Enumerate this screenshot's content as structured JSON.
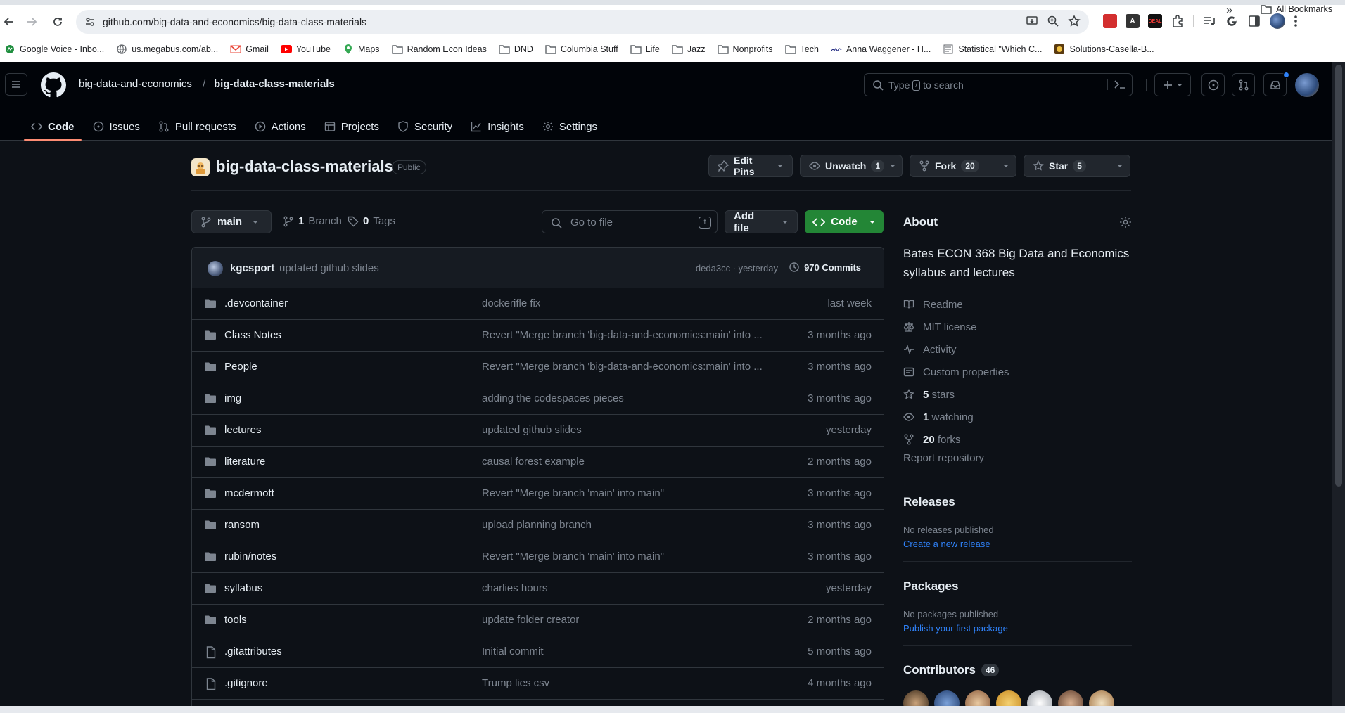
{
  "browser": {
    "url": "github.com/big-data-and-economics/big-data-class-materials",
    "bookmarks": [
      {
        "label": "Google Voice - Inbo...",
        "icon": "google-voice-icon"
      },
      {
        "label": "us.megabus.com/ab...",
        "icon": "globe-icon"
      },
      {
        "label": "Gmail",
        "icon": "gmail-icon"
      },
      {
        "label": "YouTube",
        "icon": "youtube-icon"
      },
      {
        "label": "Maps",
        "icon": "maps-pin-icon"
      },
      {
        "label": "Random Econ Ideas",
        "icon": "folder-icon"
      },
      {
        "label": "DND",
        "icon": "folder-icon"
      },
      {
        "label": "Columbia Stuff",
        "icon": "folder-icon"
      },
      {
        "label": "Life",
        "icon": "folder-icon"
      },
      {
        "label": "Jazz",
        "icon": "folder-icon"
      },
      {
        "label": "Nonprofits",
        "icon": "folder-icon"
      },
      {
        "label": "Tech",
        "icon": "folder-icon"
      },
      {
        "label": "Anna Waggener - H...",
        "icon": "signature-icon"
      },
      {
        "label": "Statistical \"Which C...",
        "icon": "doc-icon"
      },
      {
        "label": "Solutions-Casella-B...",
        "icon": "logo-icon"
      }
    ],
    "more_bookmarks": "»",
    "all_bookmarks": "All Bookmarks",
    "ext_labels": {
      "first": "",
      "second": "A",
      "third": "DEAL"
    }
  },
  "header": {
    "owner": "big-data-and-economics",
    "separator": "/",
    "repo": "big-data-class-materials",
    "search_prefix": "Type",
    "search_key": "/",
    "search_suffix": "to search"
  },
  "tabs": [
    {
      "label": "Code",
      "icon": "code-icon",
      "active": true
    },
    {
      "label": "Issues",
      "icon": "issue-icon"
    },
    {
      "label": "Pull requests",
      "icon": "pull-request-icon"
    },
    {
      "label": "Actions",
      "icon": "play-icon"
    },
    {
      "label": "Projects",
      "icon": "table-icon"
    },
    {
      "label": "Security",
      "icon": "shield-icon"
    },
    {
      "label": "Insights",
      "icon": "graph-icon"
    },
    {
      "label": "Settings",
      "icon": "gear-icon"
    }
  ],
  "repo": {
    "title": "big-data-class-materials",
    "visibility": "Public",
    "edit_pins": "Edit Pins",
    "unwatch": "Unwatch",
    "watch_count": "1",
    "fork": "Fork",
    "fork_count": "20",
    "star": "Star",
    "star_count": "5"
  },
  "branch_bar": {
    "branch": "main",
    "branches_count": "1",
    "branches_label": "Branch",
    "tags_count": "0",
    "tags_label": "Tags",
    "goto_placeholder": "Go to file",
    "goto_key": "t",
    "add_file": "Add file",
    "code": "Code"
  },
  "latest_commit": {
    "author": "kgcsport",
    "message": "updated github slides",
    "sha_time": "deda3cc · yesterday",
    "commits": "970 Commits"
  },
  "files": [
    {
      "name": ".devcontainer",
      "type": "dir",
      "commit": "dockerifle fix",
      "time": "last week"
    },
    {
      "name": "Class Notes",
      "type": "dir",
      "commit": "Revert \"Merge branch 'big-data-and-economics:main' into ...",
      "time": "3 months ago"
    },
    {
      "name": "People",
      "type": "dir",
      "commit": "Revert \"Merge branch 'big-data-and-economics:main' into ...",
      "time": "3 months ago"
    },
    {
      "name": "img",
      "type": "dir",
      "commit": "adding the codespaces pieces",
      "time": "3 months ago"
    },
    {
      "name": "lectures",
      "type": "dir",
      "commit": "updated github slides",
      "time": "yesterday"
    },
    {
      "name": "literature",
      "type": "dir",
      "commit": "causal forest example",
      "time": "2 months ago"
    },
    {
      "name": "mcdermott",
      "type": "dir",
      "commit": "Revert \"Merge branch 'main' into main\"",
      "time": "3 months ago"
    },
    {
      "name": "ransom",
      "type": "dir",
      "commit": "upload planning branch",
      "time": "3 months ago"
    },
    {
      "name": "rubin/notes",
      "type": "dir",
      "commit": "Revert \"Merge branch 'main' into main\"",
      "time": "3 months ago"
    },
    {
      "name": "syllabus",
      "type": "dir",
      "commit": "charlies hours",
      "time": "yesterday"
    },
    {
      "name": "tools",
      "type": "dir",
      "commit": "update folder creator",
      "time": "2 months ago"
    },
    {
      "name": ".gitattributes",
      "type": "file",
      "commit": "Initial commit",
      "time": "5 months ago"
    },
    {
      "name": ".gitignore",
      "type": "file",
      "commit": "Trump lies csv",
      "time": "4 months ago"
    }
  ],
  "about": {
    "heading": "About",
    "description": "Bates ECON 368 Big Data and Economics syllabus and lectures",
    "items": [
      {
        "label": "Readme",
        "icon": "book-icon",
        "strong": ""
      },
      {
        "label": "MIT license",
        "icon": "law-icon",
        "strong": ""
      },
      {
        "label": "Activity",
        "icon": "pulse-icon",
        "strong": ""
      },
      {
        "label": "Custom properties",
        "icon": "note-icon",
        "strong": ""
      },
      {
        "label": "stars",
        "icon": "star-icon",
        "strong": "5"
      },
      {
        "label": "watching",
        "icon": "eye-icon",
        "strong": "1"
      },
      {
        "label": "forks",
        "icon": "fork-icon",
        "strong": "20"
      }
    ],
    "report": "Report repository"
  },
  "releases": {
    "heading": "Releases",
    "empty": "No releases published",
    "link": "Create a new release"
  },
  "packages": {
    "heading": "Packages",
    "empty": "No packages published",
    "link": "Publish your first package"
  },
  "contributors": {
    "heading": "Contributors",
    "count": "46"
  }
}
